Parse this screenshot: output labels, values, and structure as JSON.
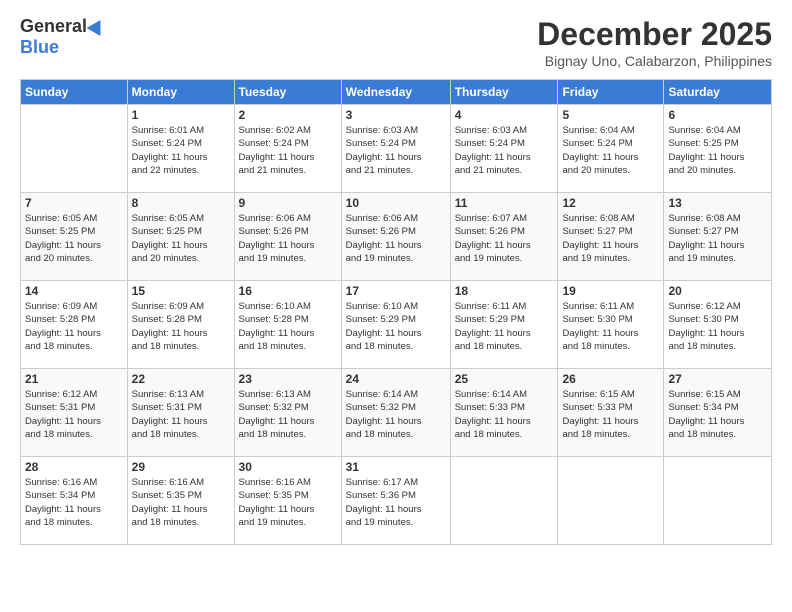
{
  "header": {
    "logo_general": "General",
    "logo_blue": "Blue",
    "month": "December 2025",
    "location": "Bignay Uno, Calabarzon, Philippines"
  },
  "weekdays": [
    "Sunday",
    "Monday",
    "Tuesday",
    "Wednesday",
    "Thursday",
    "Friday",
    "Saturday"
  ],
  "weeks": [
    [
      {
        "day": "",
        "info": ""
      },
      {
        "day": "1",
        "info": "Sunrise: 6:01 AM\nSunset: 5:24 PM\nDaylight: 11 hours\nand 22 minutes."
      },
      {
        "day": "2",
        "info": "Sunrise: 6:02 AM\nSunset: 5:24 PM\nDaylight: 11 hours\nand 21 minutes."
      },
      {
        "day": "3",
        "info": "Sunrise: 6:03 AM\nSunset: 5:24 PM\nDaylight: 11 hours\nand 21 minutes."
      },
      {
        "day": "4",
        "info": "Sunrise: 6:03 AM\nSunset: 5:24 PM\nDaylight: 11 hours\nand 21 minutes."
      },
      {
        "day": "5",
        "info": "Sunrise: 6:04 AM\nSunset: 5:24 PM\nDaylight: 11 hours\nand 20 minutes."
      },
      {
        "day": "6",
        "info": "Sunrise: 6:04 AM\nSunset: 5:25 PM\nDaylight: 11 hours\nand 20 minutes."
      }
    ],
    [
      {
        "day": "7",
        "info": "Sunrise: 6:05 AM\nSunset: 5:25 PM\nDaylight: 11 hours\nand 20 minutes."
      },
      {
        "day": "8",
        "info": "Sunrise: 6:05 AM\nSunset: 5:25 PM\nDaylight: 11 hours\nand 20 minutes."
      },
      {
        "day": "9",
        "info": "Sunrise: 6:06 AM\nSunset: 5:26 PM\nDaylight: 11 hours\nand 19 minutes."
      },
      {
        "day": "10",
        "info": "Sunrise: 6:06 AM\nSunset: 5:26 PM\nDaylight: 11 hours\nand 19 minutes."
      },
      {
        "day": "11",
        "info": "Sunrise: 6:07 AM\nSunset: 5:26 PM\nDaylight: 11 hours\nand 19 minutes."
      },
      {
        "day": "12",
        "info": "Sunrise: 6:08 AM\nSunset: 5:27 PM\nDaylight: 11 hours\nand 19 minutes."
      },
      {
        "day": "13",
        "info": "Sunrise: 6:08 AM\nSunset: 5:27 PM\nDaylight: 11 hours\nand 19 minutes."
      }
    ],
    [
      {
        "day": "14",
        "info": "Sunrise: 6:09 AM\nSunset: 5:28 PM\nDaylight: 11 hours\nand 18 minutes."
      },
      {
        "day": "15",
        "info": "Sunrise: 6:09 AM\nSunset: 5:28 PM\nDaylight: 11 hours\nand 18 minutes."
      },
      {
        "day": "16",
        "info": "Sunrise: 6:10 AM\nSunset: 5:28 PM\nDaylight: 11 hours\nand 18 minutes."
      },
      {
        "day": "17",
        "info": "Sunrise: 6:10 AM\nSunset: 5:29 PM\nDaylight: 11 hours\nand 18 minutes."
      },
      {
        "day": "18",
        "info": "Sunrise: 6:11 AM\nSunset: 5:29 PM\nDaylight: 11 hours\nand 18 minutes."
      },
      {
        "day": "19",
        "info": "Sunrise: 6:11 AM\nSunset: 5:30 PM\nDaylight: 11 hours\nand 18 minutes."
      },
      {
        "day": "20",
        "info": "Sunrise: 6:12 AM\nSunset: 5:30 PM\nDaylight: 11 hours\nand 18 minutes."
      }
    ],
    [
      {
        "day": "21",
        "info": "Sunrise: 6:12 AM\nSunset: 5:31 PM\nDaylight: 11 hours\nand 18 minutes."
      },
      {
        "day": "22",
        "info": "Sunrise: 6:13 AM\nSunset: 5:31 PM\nDaylight: 11 hours\nand 18 minutes."
      },
      {
        "day": "23",
        "info": "Sunrise: 6:13 AM\nSunset: 5:32 PM\nDaylight: 11 hours\nand 18 minutes."
      },
      {
        "day": "24",
        "info": "Sunrise: 6:14 AM\nSunset: 5:32 PM\nDaylight: 11 hours\nand 18 minutes."
      },
      {
        "day": "25",
        "info": "Sunrise: 6:14 AM\nSunset: 5:33 PM\nDaylight: 11 hours\nand 18 minutes."
      },
      {
        "day": "26",
        "info": "Sunrise: 6:15 AM\nSunset: 5:33 PM\nDaylight: 11 hours\nand 18 minutes."
      },
      {
        "day": "27",
        "info": "Sunrise: 6:15 AM\nSunset: 5:34 PM\nDaylight: 11 hours\nand 18 minutes."
      }
    ],
    [
      {
        "day": "28",
        "info": "Sunrise: 6:16 AM\nSunset: 5:34 PM\nDaylight: 11 hours\nand 18 minutes."
      },
      {
        "day": "29",
        "info": "Sunrise: 6:16 AM\nSunset: 5:35 PM\nDaylight: 11 hours\nand 18 minutes."
      },
      {
        "day": "30",
        "info": "Sunrise: 6:16 AM\nSunset: 5:35 PM\nDaylight: 11 hours\nand 19 minutes."
      },
      {
        "day": "31",
        "info": "Sunrise: 6:17 AM\nSunset: 5:36 PM\nDaylight: 11 hours\nand 19 minutes."
      },
      {
        "day": "",
        "info": ""
      },
      {
        "day": "",
        "info": ""
      },
      {
        "day": "",
        "info": ""
      }
    ]
  ]
}
